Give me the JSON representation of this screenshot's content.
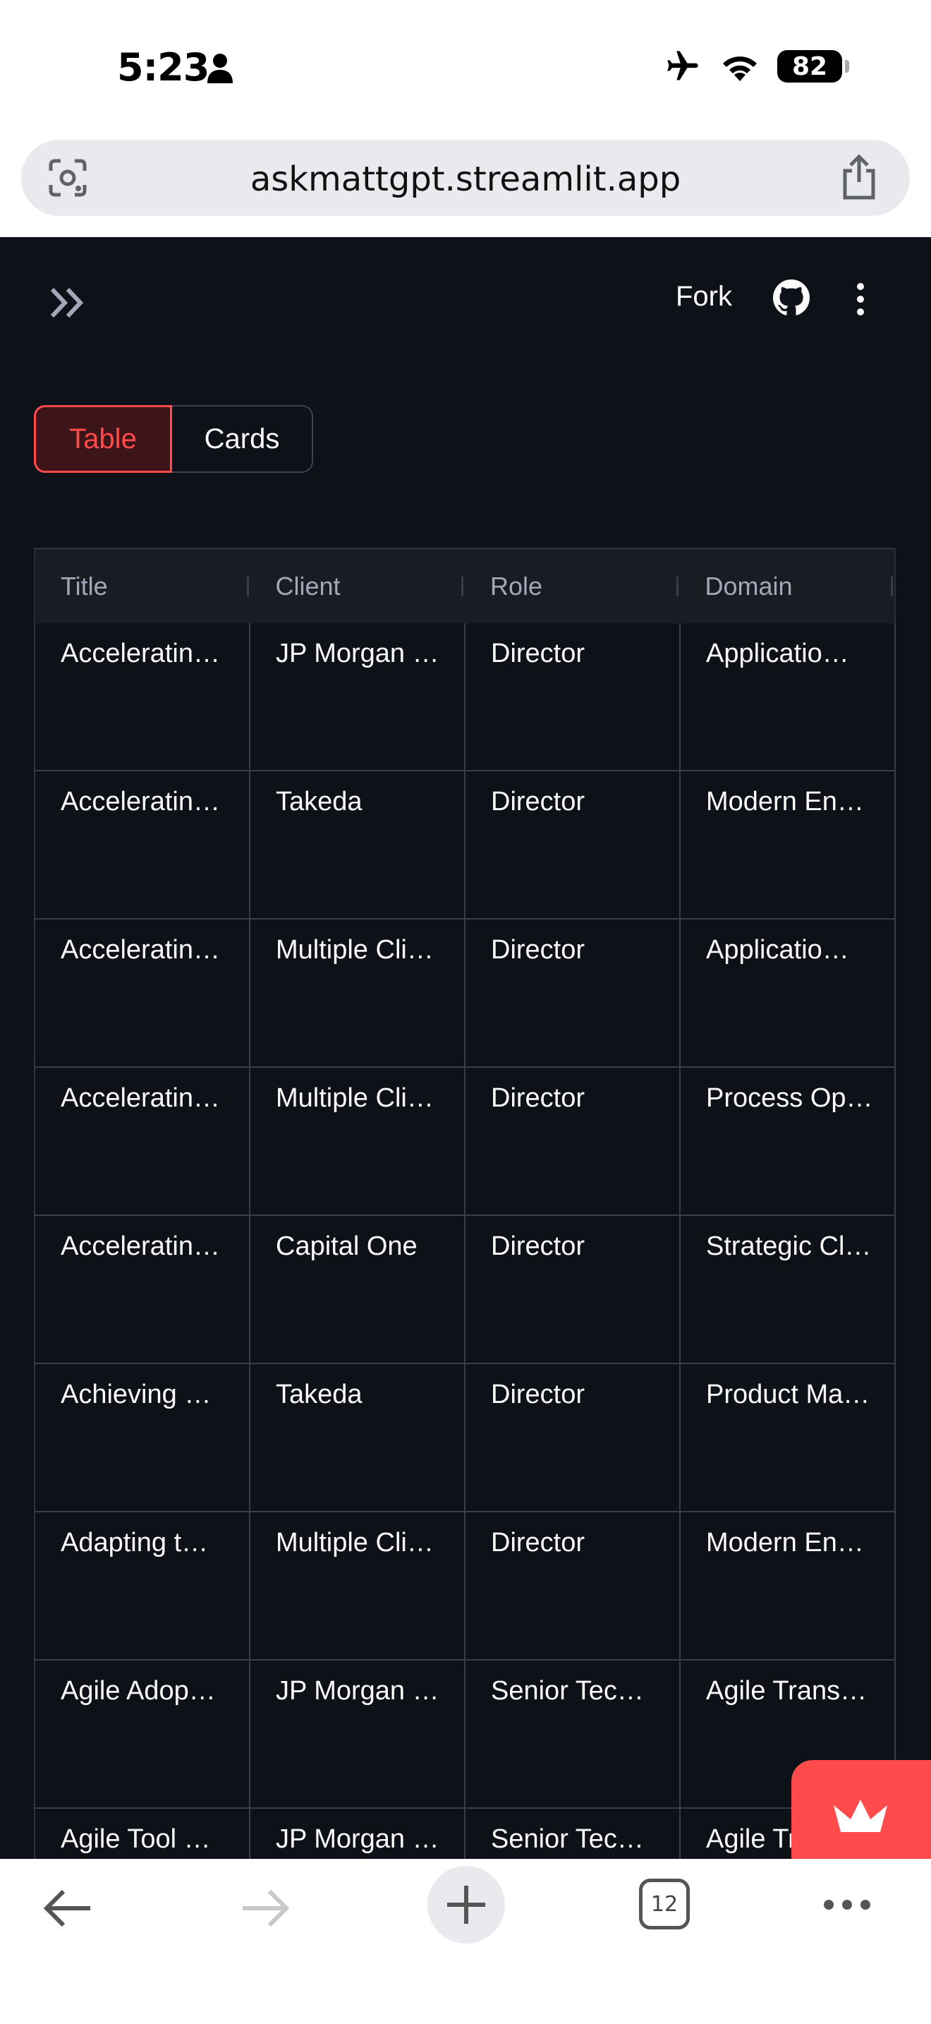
{
  "status": {
    "time": "5:23",
    "battery": "82"
  },
  "browser": {
    "url": "askmattgpt.streamlit.app",
    "tab_count": "12"
  },
  "toolbar": {
    "fork_label": "Fork"
  },
  "view_toggle": {
    "options": [
      "Table",
      "Cards"
    ],
    "selected": "Table"
  },
  "table": {
    "columns": [
      "Title",
      "Client",
      "Role",
      "Domain"
    ],
    "rows": [
      [
        "Acceleratin…",
        "JP Morgan …",
        "Director",
        "Applicatio…"
      ],
      [
        "Acceleratin…",
        "Takeda",
        "Director",
        "Modern En…"
      ],
      [
        "Acceleratin…",
        "Multiple Cli…",
        "Director",
        "Applicatio…"
      ],
      [
        "Acceleratin…",
        "Multiple Cli…",
        "Director",
        "Process Op…"
      ],
      [
        "Acceleratin…",
        "Capital One",
        "Director",
        "Strategic Cl…"
      ],
      [
        "Achieving …",
        "Takeda",
        "Director",
        "Product Ma…"
      ],
      [
        "Adapting t…",
        "Multiple Cli…",
        "Director",
        "Modern En…"
      ],
      [
        "Agile Adop…",
        "JP Morgan …",
        "Senior Tec…",
        "Agile Trans…"
      ],
      [
        "Agile Tool …",
        "JP Morgan …",
        "Senior Tec…",
        "Agile Tr"
      ]
    ]
  },
  "colors": {
    "accent": "#ff4b4b",
    "background": "#0e1117",
    "header_bg": "#1a1c24"
  }
}
